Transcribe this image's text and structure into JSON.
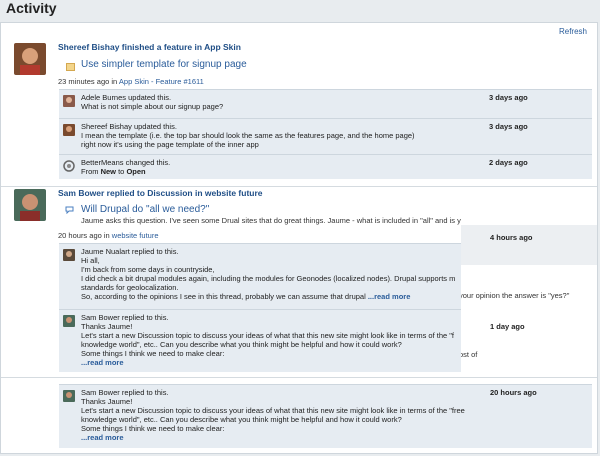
{
  "page": {
    "title": "Activity",
    "refresh_label": "Refresh"
  },
  "items": [
    {
      "headline": "Shereef Bishay finished a feature in App Skin",
      "subtitle": "Use simpler template for signup page",
      "meta_prefix": "23 minutes ago in ",
      "meta_link": "App Skin - Feature #1611",
      "comments": [
        {
          "name": "Adele Burnes",
          "verb": " updated this.",
          "lines": [
            "What is not simple about our signup page?"
          ],
          "time": "3 days ago"
        },
        {
          "name": "Shereef Bishay",
          "verb": " updated this.",
          "lines": [
            "I mean the template (i.e. the top bar should look the same as the features page, and the home page)",
            "right now it's using the page template of the inner app"
          ],
          "time": "3 days ago"
        },
        {
          "name": "BetterMeans",
          "verb": " changed this.",
          "from_label": "From ",
          "from_value": "New",
          "to_label": " to ",
          "to_value": "Open",
          "time": "2 days ago"
        }
      ]
    },
    {
      "headline": "Sam Bower replied to Discussion in website future",
      "subtitle": "Will Drupal do \"all we need?\"",
      "body": "Jaume asks this question. I've seen some Drual sites that do great things. Jaume - what is included in \"all\" and is y",
      "meta_prefix": "20 hours ago in ",
      "meta_link": "website future",
      "meta_time": "4 hours ago",
      "behind_text": "your opinion the answer is \"yes?\"",
      "behind_text2": "ost of",
      "comments": [
        {
          "name": "Jaume Nualart",
          "verb": " replied to this.",
          "lines": [
            "Hi all,",
            "I'm back from some days in countryside,",
            "I did check a bit drupal modules again, including the modules for Geonodes (localized nodes). Drupal supports m",
            "standards for geolocalization.",
            "So, according to the opinions I see in this thread, probably we can assume that drupal "
          ],
          "more": "...read more"
        },
        {
          "name": "Sam Bower",
          "verb": " replied to this.",
          "lines": [
            "Thanks Jaume!",
            "Let's start a new Discussion topic to discuss your ideas of what that this new site might look like in terms of the \"f",
            "knowledge world\", etc.. Can you describe what you think might be helpful and how it could work?",
            "Some things I think we need to make clear:"
          ],
          "more": "...read more",
          "time": "1 day ago"
        }
      ]
    },
    {
      "comments": [
        {
          "name": "Sam Bower",
          "verb": " replied to this.",
          "lines": [
            "Thanks Jaume!",
            "Let's start a new Discussion topic to discuss your ideas of what that this new site might look like in terms of the \"free",
            "knowledge world\", etc.. Can you describe what you think might be helpful and how it could work?",
            "Some things I think we need to make clear:"
          ],
          "more": "...read more",
          "time": "20 hours ago"
        }
      ]
    }
  ]
}
